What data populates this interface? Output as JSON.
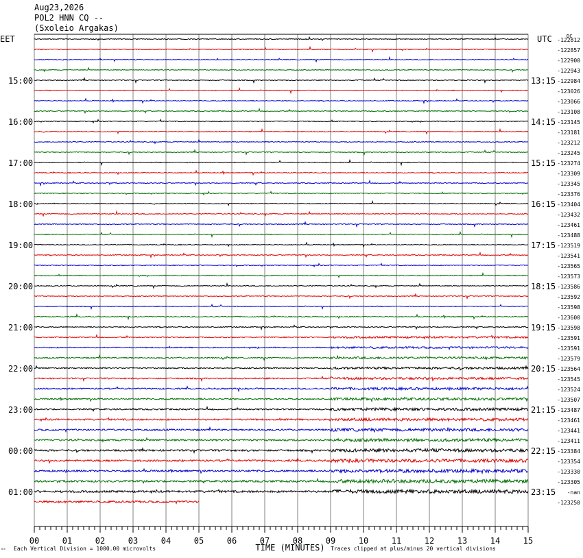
{
  "header": {
    "date": "Aug23,2026",
    "station": "POL2 HNN CQ --",
    "location": "(Sxoleio Argakas)"
  },
  "footer": {
    "marker": "⁴⁶",
    "scale_note": "Each Vertical Division = 1000.00 microvolts",
    "clip_note": "Traces clipped at plus/minus 20 vertical divisions"
  },
  "colors": {
    "trace_cycle": [
      "#000000",
      "#e00000",
      "#0000d0",
      "#007000"
    ],
    "grid": "#808080"
  },
  "chart_data": {
    "type": "line",
    "title": "",
    "xlabel": "TIME (MINUTES)",
    "left_tz": "EET",
    "right_tz": "UTC",
    "dc_label": "DC",
    "xlim": [
      0,
      15
    ],
    "x_ticks": [
      "00",
      "01",
      "02",
      "03",
      "04",
      "05",
      "06",
      "07",
      "08",
      "09",
      "10",
      "11",
      "12",
      "13",
      "14",
      "15"
    ],
    "grid": true,
    "left_hour_labels": [
      "15:00",
      "16:00",
      "17:00",
      "18:00",
      "19:00",
      "20:00",
      "21:00",
      "22:00",
      "23:00",
      "00:00",
      "01:00"
    ],
    "right_hour_labels": [
      "13:15",
      "14:15",
      "15:15",
      "16:15",
      "17:15",
      "18:15",
      "19:15",
      "20:15",
      "21:15",
      "22:15",
      "23:15"
    ],
    "dc_offsets": [
      "-122812",
      "-122857",
      "-122900",
      "-122943",
      "-122984",
      "-123026",
      "-123066",
      "-123108",
      "-123145",
      "-123181",
      "-123212",
      "-123245",
      "-123274",
      "-123309",
      "-123345",
      "-123376",
      "-123404",
      "-123432",
      "-123461",
      "-123488",
      "-123519",
      "-123541",
      "-123565",
      "-123573",
      "-123586",
      "-123592",
      "-123598",
      "-123600",
      "-123598",
      "-123591",
      "-123591",
      "-123579",
      "-123564",
      "-123545",
      "-123524",
      "-123507",
      "-123487",
      "-123461",
      "-123441",
      "-123411",
      "-123384",
      "-123354",
      "-123330",
      "-123305",
      "-nan",
      "-123250"
    ],
    "series_count": 46,
    "last_trace_end_minute": 5
  }
}
